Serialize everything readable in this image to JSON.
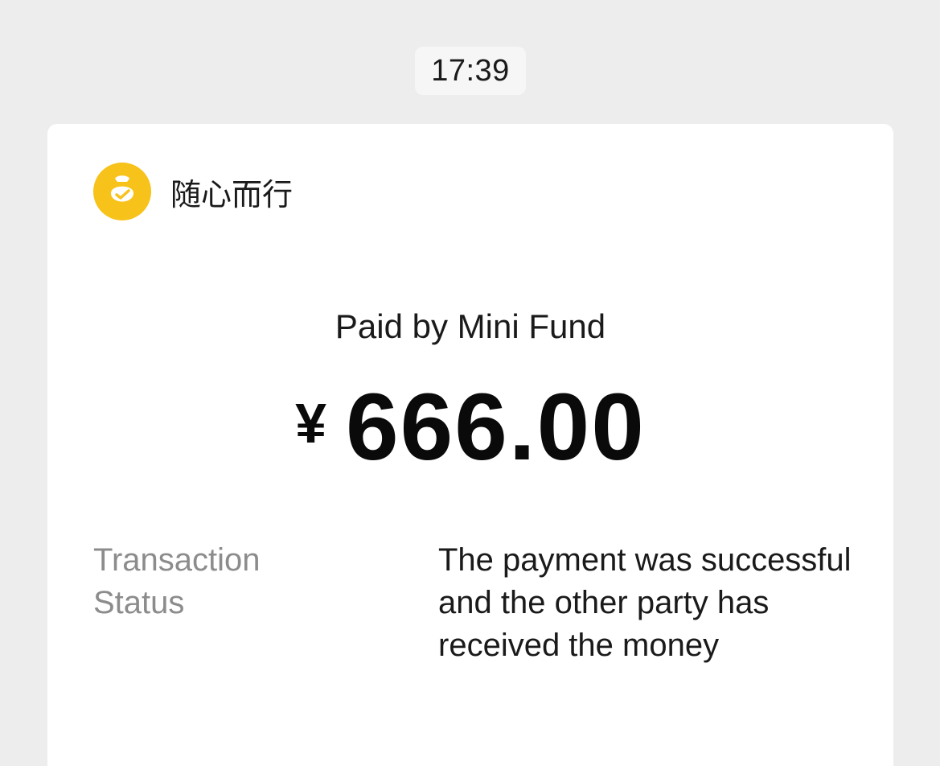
{
  "timestamp": "17:39",
  "merchant": {
    "name": "随心而行",
    "icon": "mini-fund-bag-icon",
    "icon_color": "#f7c21a"
  },
  "payment": {
    "method_text": "Paid by Mini Fund",
    "currency_symbol": "¥",
    "amount": "666.00"
  },
  "details": [
    {
      "label": "Transaction Status",
      "value": "The payment was successful and the other party has received the money"
    }
  ]
}
